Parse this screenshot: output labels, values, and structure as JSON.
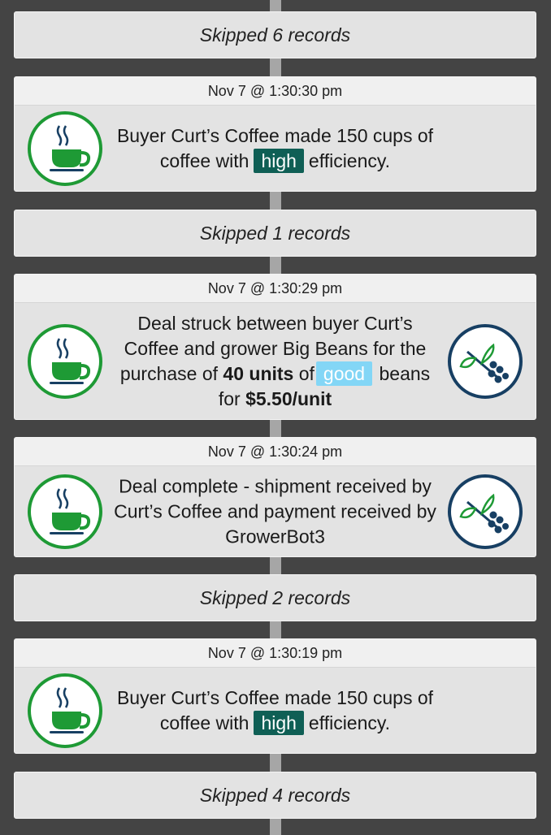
{
  "feed": {
    "skip_1": "Skipped 6 records",
    "event_1": {
      "timestamp": "Nov 7 @ 1:30:30 pm",
      "text_a": "Buyer Curt’s Coffee made 150 cups of coffee with",
      "tag": "high",
      "text_b": "efficiency.",
      "icon": "coffee-cup-icon"
    },
    "skip_2": "Skipped 1 records",
    "event_2": {
      "timestamp": "Nov 7 @ 1:30:29 pm",
      "text_a": "Deal struck between buyer Curt’s Coffee and grower Big Beans for the purchase of",
      "units": "40 units",
      "text_b": "of",
      "tag": "good",
      "text_c": "beans for",
      "price": "$5.50/unit",
      "icon_left": "coffee-cup-icon",
      "icon_right": "coffee-plant-icon"
    },
    "event_3": {
      "timestamp": "Nov 7 @ 1:30:24 pm",
      "text": "Deal complete - shipment received by Curt’s Coffee and payment received by GrowerBot3",
      "icon_left": "coffee-cup-icon",
      "icon_right": "coffee-plant-icon"
    },
    "skip_3": "Skipped 2 records",
    "event_4": {
      "timestamp": "Nov 7 @ 1:30:19 pm",
      "text_a": "Buyer Curt’s Coffee made 150 cups of coffee with",
      "tag": "high",
      "text_b": "efficiency.",
      "icon": "coffee-cup-icon"
    },
    "skip_4": "Skipped 4 records"
  },
  "colors": {
    "background": "#444444",
    "spine": "#a6a6a6",
    "card": "#e3e3e3",
    "buyer_green": "#1e9a35",
    "grower_navy": "#173f63",
    "tag_high": "#0f5f55",
    "tag_good": "#83d6f6"
  }
}
